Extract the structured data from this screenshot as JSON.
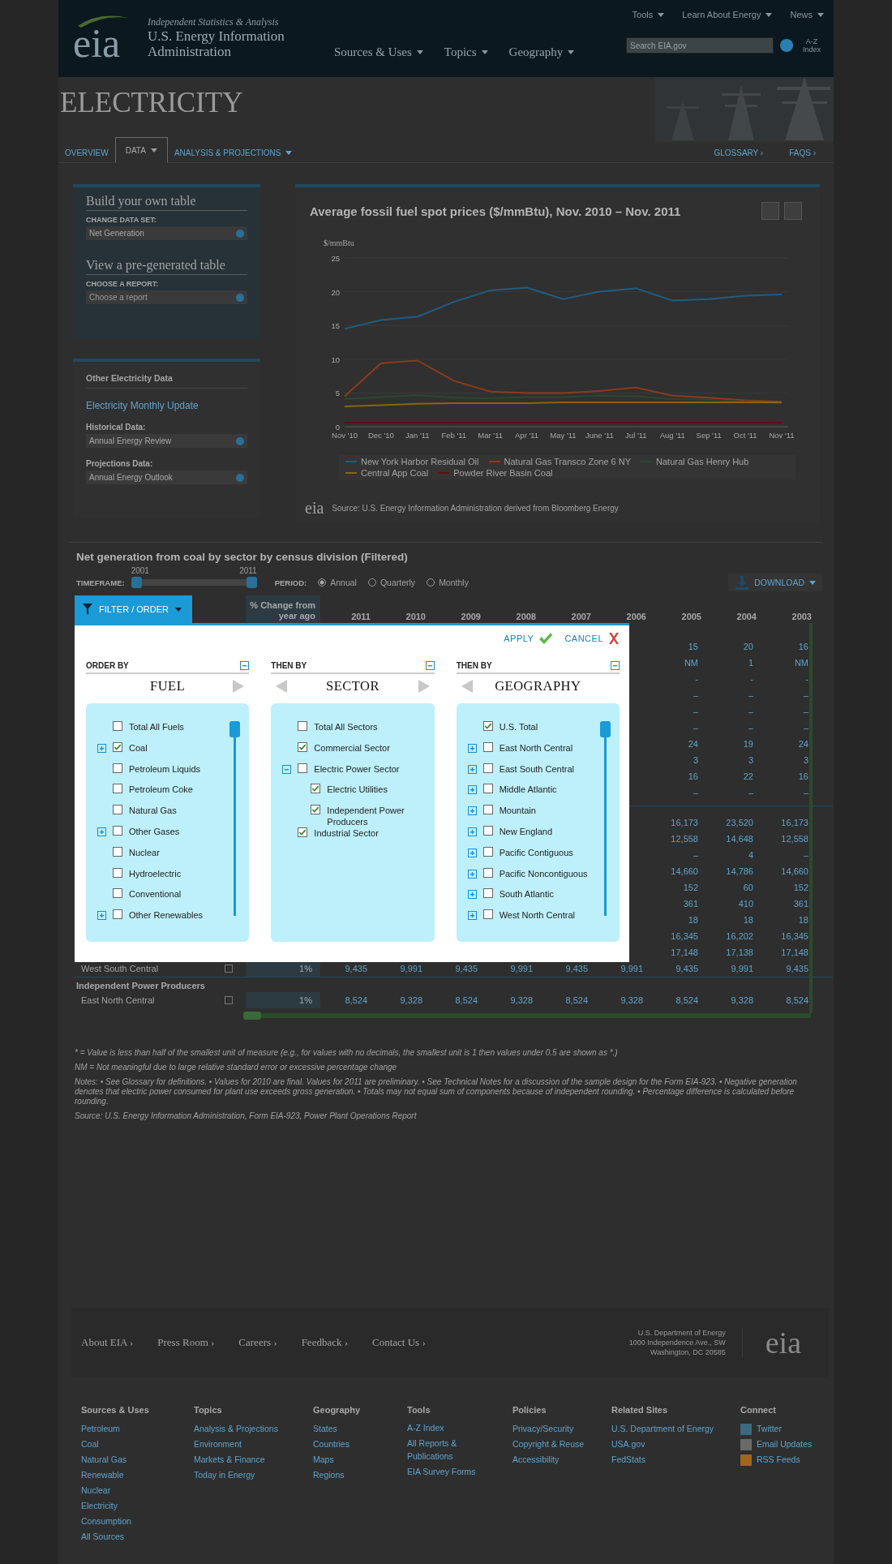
{
  "header": {
    "logo": "eia",
    "tagline": "Independent Statistics & Analysis",
    "org_line_1": "U.S. Energy Information",
    "org_line_2": "Administration",
    "top_links": [
      "Tools",
      "Learn About Energy",
      "News"
    ],
    "nav": [
      "Sources & Uses",
      "Topics",
      "Geography"
    ],
    "search": {
      "placeholder": "Search EIA.gov"
    },
    "az_index": "A-Z Index"
  },
  "page_title": "ELECTRICITY",
  "tabs": [
    {
      "label": "OVERVIEW",
      "selected": false,
      "dropdown": false
    },
    {
      "label": "DATA",
      "selected": true,
      "dropdown": true
    },
    {
      "label": "ANALYSIS & PROJECTIONS",
      "selected": false,
      "dropdown": true
    }
  ],
  "tab_links": [
    "GLOSSARY ›",
    "FAQS ›"
  ],
  "sidebar": {
    "build_title": "Build your own table",
    "data_set_label": "CHANGE DATA SET:",
    "data_set_value": "Net Generation",
    "pregen_title": "View a pre-generated table",
    "report_label": "CHOOSE A REPORT:",
    "report_placeholder": "Choose a report",
    "other_title": "Other Electricity Data",
    "other_link": "Electricity Monthly Update",
    "historical_label": "Historical Data:",
    "historical_value": "Annual Energy Review",
    "projections_label": "Projections Data:",
    "projections_value": "Annual Energy Outlook"
  },
  "chart_panel": {
    "title": "Average fossil fuel spot prices ($/mmBtu), Nov. 2010 – Nov. 2011",
    "source": "Source: U.S. Energy Information Administration derived from Bloomberg Energy",
    "source_logo": "eia",
    "chart_data": {
      "type": "line",
      "ylabel": "$/mmBtu",
      "categories": [
        "Nov '10",
        "Dec '10",
        "Jan '11",
        "Feb '11",
        "Mar '11",
        "Apr '11",
        "May '11",
        "June '11",
        "Jul '11",
        "Aug '11",
        "Sep '11",
        "Oct '11",
        "Nov '11"
      ],
      "ylim": [
        0,
        25
      ],
      "yticks": [
        0,
        5,
        10,
        15,
        20,
        25
      ],
      "series": [
        {
          "name": "New York Harbor Residual Oil",
          "color": "#1f5d82",
          "values": [
            14.5,
            15.8,
            16.3,
            18.5,
            20.2,
            20.6,
            18.9,
            20,
            20.5,
            18.7,
            18.9,
            19.4,
            19.6
          ]
        },
        {
          "name": "Natural Gas Transco Zone 6 NY",
          "color": "#8a3b1c",
          "values": [
            4.5,
            9.4,
            9.8,
            6.8,
            5.2,
            5,
            5,
            5.3,
            5.8,
            4.6,
            4.3,
            3.9,
            3.7
          ]
        },
        {
          "name": "Natural Gas Henry Hub",
          "color": "#2c4630",
          "values": [
            4.1,
            4.4,
            4.7,
            4.3,
            4.2,
            4.4,
            4.4,
            4.6,
            4.5,
            4.1,
            4,
            3.7,
            3.5
          ]
        },
        {
          "name": "Central App Coal",
          "color": "#8a6412",
          "values": [
            3,
            3.2,
            3.4,
            3.5,
            3.5,
            3.5,
            3.6,
            3.6,
            3.6,
            3.6,
            3.6,
            3.6,
            3.6
          ]
        },
        {
          "name": "Powder River Basin Coal",
          "color": "#5c1010",
          "values": [
            0.6,
            0.6,
            0.6,
            0.6,
            0.6,
            0.6,
            0.6,
            0.6,
            0.6,
            0.6,
            0.6,
            0.6,
            0.6
          ]
        }
      ]
    }
  },
  "table_title": "Net generation from coal by sector by census division (Filtered)",
  "timeframe": {
    "label": "TIMEFRAME:",
    "start": "2001",
    "end": "2011",
    "level": 1
  },
  "period": {
    "label": "PERIOD:",
    "options": [
      {
        "label": "Annual",
        "selected": true
      },
      {
        "label": "Quarterly",
        "selected": false
      },
      {
        "label": "Monthly",
        "selected": false
      }
    ]
  },
  "download": "DOWNLOAD",
  "filter_button": "FILTER / ORDER",
  "table": {
    "columns": [
      "% Change from year ago",
      "2011",
      "2010",
      "2009",
      "2008",
      "2007",
      "2006",
      "2005",
      "2004",
      "2003"
    ],
    "groups": [
      {
        "rows": [
          {
            "tail": [
              "15",
              "20",
              "16"
            ]
          },
          {
            "tail": [
              "NM",
              "1",
              "NM"
            ]
          },
          {
            "tail": [
              "-",
              "-",
              "-"
            ]
          },
          {
            "tail": [
              "–",
              "–",
              "–"
            ]
          },
          {
            "tail": [
              "–",
              "–",
              "–"
            ]
          },
          {
            "tail": [
              "–",
              "–",
              "–"
            ]
          },
          {
            "tail": [
              "24",
              "19",
              "24"
            ]
          },
          {
            "tail": [
              "3",
              "3",
              "3"
            ]
          },
          {
            "tail": [
              "16",
              "22",
              "16"
            ]
          },
          {
            "tail": [
              "–",
              "–",
              "–"
            ]
          }
        ]
      },
      {
        "rows": [
          {
            "tail": [
              "16,173",
              "23,520",
              "16,173"
            ]
          },
          {
            "tail": [
              "12,558",
              "14,648",
              "12,558"
            ]
          },
          {
            "tail": [
              "–",
              "4",
              "–"
            ]
          },
          {
            "tail": [
              "14,660",
              "14,786",
              "14,660"
            ]
          },
          {
            "tail": [
              "152",
              "60",
              "152"
            ]
          },
          {
            "tail": [
              "361",
              "410",
              "361"
            ]
          },
          {
            "tail": [
              "18",
              "18",
              "18"
            ]
          },
          {
            "tail": [
              "16,345",
              "16,202",
              "16,345"
            ]
          },
          {
            "tail": [
              "17,148",
              "17,138",
              "17,148"
            ]
          },
          {
            "label": "West South Central",
            "values": [
              "1%",
              "9,435",
              "9,991",
              "9,435",
              "9,991",
              "9,435",
              "9,991",
              "9,435",
              "9,991",
              "9,435"
            ]
          }
        ]
      },
      {
        "heading": "Independent Power Producers",
        "rows": [
          {
            "label": "East North Central",
            "values": [
              "1%",
              "8,524",
              "9,328",
              "8,524",
              "9,328",
              "8,524",
              "9,328",
              "8,524",
              "9,328",
              "8,524"
            ]
          }
        ]
      }
    ]
  },
  "filter_dialog": {
    "apply": "APPLY",
    "cancel": "CANCEL",
    "panels": [
      {
        "label": "ORDER BY",
        "title": "FUEL",
        "prev": false,
        "next": true,
        "scroll": true,
        "items": [
          {
            "label": "Total All Fuels",
            "kind": "item",
            "checked": false
          },
          {
            "label": "Coal",
            "kind": "group",
            "expanded": false,
            "checked": true
          },
          {
            "label": "Petroleum Liquids",
            "kind": "item",
            "checked": false
          },
          {
            "label": "Petroleum Coke",
            "kind": "item",
            "checked": false
          },
          {
            "label": "Natural Gas",
            "kind": "item",
            "checked": false
          },
          {
            "label": "Other Gases",
            "kind": "group",
            "expanded": false,
            "checked": false
          },
          {
            "label": "Nuclear",
            "kind": "item",
            "checked": false
          },
          {
            "label": "Hydroelectric",
            "kind": "item",
            "checked": false
          },
          {
            "label": "Conventional",
            "kind": "item",
            "checked": false
          },
          {
            "label": "Other Renewables",
            "kind": "group",
            "expanded": false,
            "checked": false
          }
        ]
      },
      {
        "label": "THEN BY",
        "title": "SECTOR",
        "prev": true,
        "next": true,
        "scroll": false,
        "items": [
          {
            "label": "Total All Sectors",
            "kind": "item",
            "checked": false
          },
          {
            "label": "Commercial Sector",
            "kind": "item",
            "checked": true
          },
          {
            "label": "Electric Power Sector",
            "kind": "group",
            "expanded": true,
            "checked": false,
            "children": [
              {
                "label": "Electric Utilities",
                "kind": "item",
                "checked": true
              },
              {
                "label": "Independent Power Producers",
                "kind": "item",
                "checked": true
              }
            ]
          },
          {
            "label": "Industrial Sector",
            "kind": "item",
            "checked": true
          }
        ]
      },
      {
        "label": "THEN BY",
        "title": "GEOGRAPHY",
        "prev": true,
        "next": false,
        "scroll": true,
        "items": [
          {
            "label": "U.S. Total",
            "kind": "item",
            "checked": true
          },
          {
            "label": "East North Central",
            "kind": "group",
            "expanded": false,
            "checked": false
          },
          {
            "label": "East South Central",
            "kind": "group",
            "expanded": false,
            "checked": false
          },
          {
            "label": "Middle Atlantic",
            "kind": "group",
            "expanded": false,
            "checked": false
          },
          {
            "label": "Mountain",
            "kind": "group",
            "expanded": false,
            "checked": false
          },
          {
            "label": "New England",
            "kind": "group",
            "expanded": false,
            "checked": false
          },
          {
            "label": "Pacific Contiguous",
            "kind": "group",
            "expanded": false,
            "checked": false
          },
          {
            "label": "Pacific Noncontiguous",
            "kind": "group",
            "expanded": false,
            "checked": false
          },
          {
            "label": "South Atlantic",
            "kind": "group",
            "expanded": false,
            "checked": false
          },
          {
            "label": "West North Central",
            "kind": "group",
            "expanded": false,
            "checked": false
          }
        ]
      }
    ]
  },
  "notes": [
    "* = Value is less than half of the smallest unit of measure (e.g., for values with no decimals, the smallest unit is 1 then values under 0.5 are shown as *.)",
    "NM = Not meaningful due to large relative standard error or excessive percentage change",
    "Notes: • See Glossary for definitions. • Values for 2010 are final. Values for 2011 are preliminary. • See Technical Notes for a discussion of the sample design for the Form EIA-923. • Negative generation denotes that electric power consumed for plant use exceeds gross generation. • Totals may not equal sum of components because of independent rounding. • Percentage difference is calculated before rounding.",
    "Source: U.S. Energy Information Administration, Form EIA-923, Power Plant Operations Report"
  ],
  "footer": {
    "links": [
      "About EIA ›",
      "Press Room ›",
      "Careers ›",
      "Feedback ›",
      "Contact Us ›"
    ],
    "address": [
      "U.S. Department of Energy",
      "1000 Independence Ave., SW",
      "Washington, DC 20585"
    ],
    "logo": "eia",
    "columns": [
      {
        "heading": "Sources & Uses",
        "links": [
          "Petroleum",
          "Coal",
          "Natural Gas",
          "Renewable",
          "Nuclear",
          "Electricity",
          "Consumption",
          "All Sources"
        ]
      },
      {
        "heading": "Topics",
        "links": [
          "Analysis & Projections",
          "Environment",
          "Markets & Finance",
          "Today in Energy"
        ]
      },
      {
        "heading": "Geography",
        "links": [
          "States",
          "Countries",
          "Maps",
          "Regions"
        ]
      },
      {
        "heading": "Tools",
        "links": [
          "A-Z Index",
          "All Reports & Publications",
          "EIA Survey Forms"
        ]
      },
      {
        "heading": "Policies",
        "links": [
          "Privacy/Security",
          "Copyright & Reuse",
          "Accessibility"
        ]
      },
      {
        "heading": "Related Sites",
        "links": [
          "U.S. Department of Energy",
          "USA.gov",
          "FedStats"
        ]
      },
      {
        "heading": "Connect",
        "kind": "social",
        "links": [
          "Twitter",
          "Email Updates",
          "RSS Feeds"
        ]
      }
    ]
  }
}
